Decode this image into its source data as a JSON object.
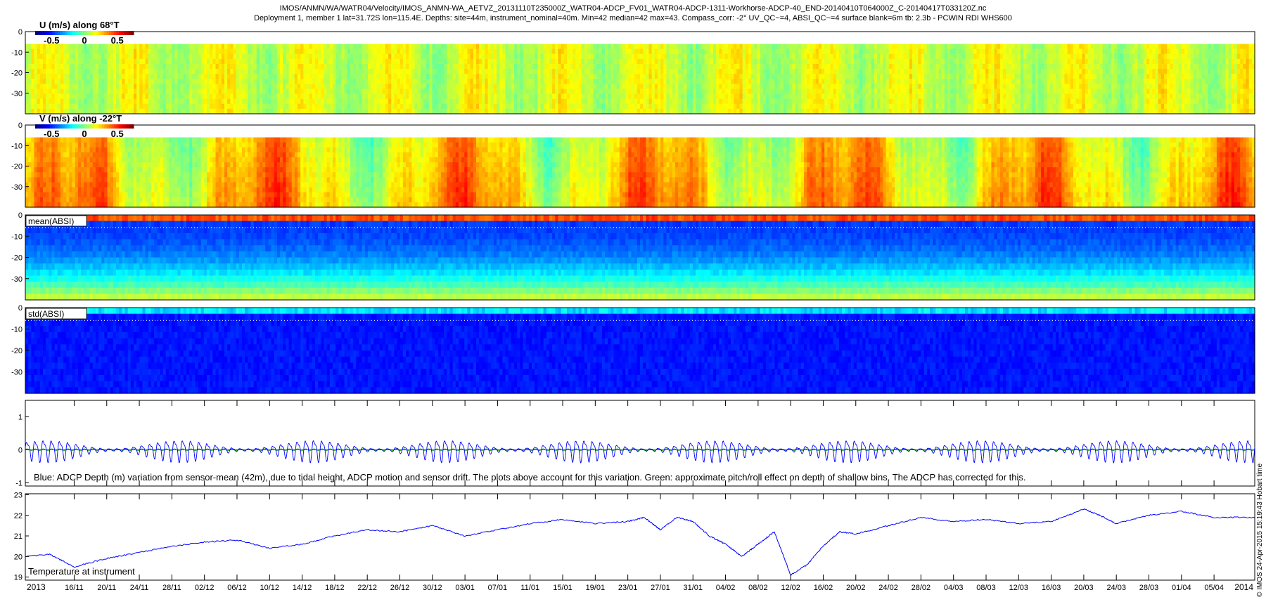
{
  "header": {
    "title_line1": "IMOS/ANMN/WA/WATR04/Velocity/IMOS_ANMN-WA_AETVZ_20131110T235000Z_WATR04-ADCP_FV01_WATR04-ADCP-1311-Workhorse-ADCP-40_END-20140410T064000Z_C-20140417T033120Z.nc",
    "title_line2": "Deployment 1, member 1 lat=31.72S lon=115.4E. Depths: site=44m, instrument_nominal=40m. Min=42 median=42 max=43. Compass_corr: -2° UV_QC~=4, ABSI_QC~=4 surface blank=6m tb: 2.3b - PCWIN RDI WHS600"
  },
  "side_label": "© IMOS 24-Apr-2015 15:19:43 Hobart time",
  "chart_data": [
    {
      "type": "heatmap",
      "title": "U (m/s) along 68°T",
      "colorbar": {
        "ticks": [
          "-0.5",
          "0",
          "0.5"
        ],
        "range": [
          -0.75,
          0.75
        ]
      },
      "y_ticks": [
        "0",
        "-10",
        "-20",
        "-30"
      ],
      "ylim": [
        -40,
        0
      ],
      "colormap": "jet",
      "surface_blank_depth": -6
    },
    {
      "type": "heatmap",
      "title": "V (m/s) along -22°T",
      "colorbar": {
        "ticks": [
          "-0.5",
          "0",
          "0.5"
        ],
        "range": [
          -0.75,
          0.75
        ]
      },
      "y_ticks": [
        "0",
        "-10",
        "-20",
        "-30"
      ],
      "ylim": [
        -40,
        0
      ],
      "colormap": "jet",
      "surface_blank_depth": -6
    },
    {
      "type": "heatmap",
      "title": "mean(ABSI)",
      "y_ticks": [
        "0",
        "-10",
        "-20",
        "-30"
      ],
      "ylim": [
        -40,
        0
      ],
      "colormap": "jet",
      "dotted_line_depth": -6
    },
    {
      "type": "heatmap",
      "title": "std(ABSI)",
      "y_ticks": [
        "0",
        "-10",
        "-20",
        "-30"
      ],
      "ylim": [
        -40,
        0
      ],
      "colormap": "jet",
      "dotted_line_depth": -6
    },
    {
      "type": "line",
      "annotation": "Blue: ADCP Depth (m) variation from sensor-mean (42m), due to tidal height, ADCP motion and sensor drift. The plots above account for this variation. Green: approximate pitch/roll effect on depth of shallow bins. The ADCP has corrected for this.",
      "y_ticks": [
        "1",
        "0",
        "-1"
      ],
      "ylim": [
        -1.1,
        1.5
      ],
      "series": [
        {
          "color": "#0000ff",
          "amplitude": 0.3
        },
        {
          "color": "#00a000",
          "amplitude": 0.03
        }
      ]
    },
    {
      "type": "line",
      "annotation": "Temperature at instrument",
      "y_ticks": [
        "23",
        "22",
        "21",
        "20",
        "19"
      ],
      "ylim": [
        18.85,
        23.05
      ],
      "series": [
        {
          "color": "#0000ff",
          "x": [
            "2013-11-10",
            "2013-11-13",
            "2013-11-16",
            "2013-11-20",
            "2013-11-24",
            "2013-11-28",
            "2013-12-02",
            "2013-12-06",
            "2013-12-10",
            "2013-12-14",
            "2013-12-18",
            "2013-12-22",
            "2013-12-26",
            "2013-12-30",
            "2014-01-03",
            "2014-01-07",
            "2014-01-11",
            "2014-01-15",
            "2014-01-19",
            "2014-01-23",
            "2014-01-25",
            "2014-01-27",
            "2014-01-29",
            "2014-01-31",
            "2014-02-02",
            "2014-02-04",
            "2014-02-06",
            "2014-02-08",
            "2014-02-10",
            "2014-02-12",
            "2014-02-14",
            "2014-02-16",
            "2014-02-18",
            "2014-02-20",
            "2014-02-24",
            "2014-02-28",
            "2014-03-04",
            "2014-03-08",
            "2014-03-12",
            "2014-03-16",
            "2014-03-20",
            "2014-03-22",
            "2014-03-24",
            "2014-03-28",
            "2014-04-01",
            "2014-04-05",
            "2014-04-10"
          ],
          "y": [
            20.0,
            20.1,
            19.5,
            19.9,
            20.2,
            20.5,
            20.7,
            20.8,
            20.4,
            20.6,
            21.0,
            21.3,
            21.2,
            21.5,
            21.0,
            21.3,
            21.6,
            21.8,
            21.6,
            21.7,
            21.9,
            21.3,
            21.9,
            21.7,
            21.0,
            20.6,
            20.0,
            20.6,
            21.2,
            19.1,
            19.6,
            20.5,
            21.2,
            21.1,
            21.5,
            21.9,
            21.7,
            21.8,
            21.6,
            21.7,
            22.3,
            22.0,
            21.6,
            22.0,
            22.2,
            21.9,
            21.9
          ]
        }
      ]
    }
  ],
  "time_axis": {
    "start": "2013-11-10",
    "end": "2014-04-10",
    "labels": [
      {
        "date": "2013-11-16",
        "text": "16/11"
      },
      {
        "date": "2013-11-20",
        "text": "20/11"
      },
      {
        "date": "2013-11-24",
        "text": "24/11"
      },
      {
        "date": "2013-11-28",
        "text": "28/11"
      },
      {
        "date": "2013-12-02",
        "text": "02/12"
      },
      {
        "date": "2013-12-06",
        "text": "06/12"
      },
      {
        "date": "2013-12-10",
        "text": "10/12"
      },
      {
        "date": "2013-12-14",
        "text": "14/12"
      },
      {
        "date": "2013-12-18",
        "text": "18/12"
      },
      {
        "date": "2013-12-22",
        "text": "22/12"
      },
      {
        "date": "2013-12-26",
        "text": "26/12"
      },
      {
        "date": "2013-12-30",
        "text": "30/12"
      },
      {
        "date": "2014-01-03",
        "text": "03/01"
      },
      {
        "date": "2014-01-07",
        "text": "07/01"
      },
      {
        "date": "2014-01-11",
        "text": "11/01"
      },
      {
        "date": "2014-01-15",
        "text": "15/01"
      },
      {
        "date": "2014-01-19",
        "text": "19/01"
      },
      {
        "date": "2014-01-23",
        "text": "23/01"
      },
      {
        "date": "2014-01-27",
        "text": "27/01"
      },
      {
        "date": "2014-01-31",
        "text": "31/01"
      },
      {
        "date": "2014-02-04",
        "text": "04/02"
      },
      {
        "date": "2014-02-08",
        "text": "08/02"
      },
      {
        "date": "2014-02-12",
        "text": "12/02"
      },
      {
        "date": "2014-02-16",
        "text": "16/02"
      },
      {
        "date": "2014-02-20",
        "text": "20/02"
      },
      {
        "date": "2014-02-24",
        "text": "24/02"
      },
      {
        "date": "2014-02-28",
        "text": "28/02"
      },
      {
        "date": "2014-03-04",
        "text": "04/03"
      },
      {
        "date": "2014-03-08",
        "text": "08/03"
      },
      {
        "date": "2014-03-12",
        "text": "12/03"
      },
      {
        "date": "2014-03-16",
        "text": "16/03"
      },
      {
        "date": "2014-03-20",
        "text": "20/03"
      },
      {
        "date": "2014-03-24",
        "text": "24/03"
      },
      {
        "date": "2014-03-28",
        "text": "28/03"
      },
      {
        "date": "2014-04-01",
        "text": "01/04"
      },
      {
        "date": "2014-04-05",
        "text": "05/04"
      }
    ],
    "start_label": "2013",
    "end_label": "2014"
  }
}
